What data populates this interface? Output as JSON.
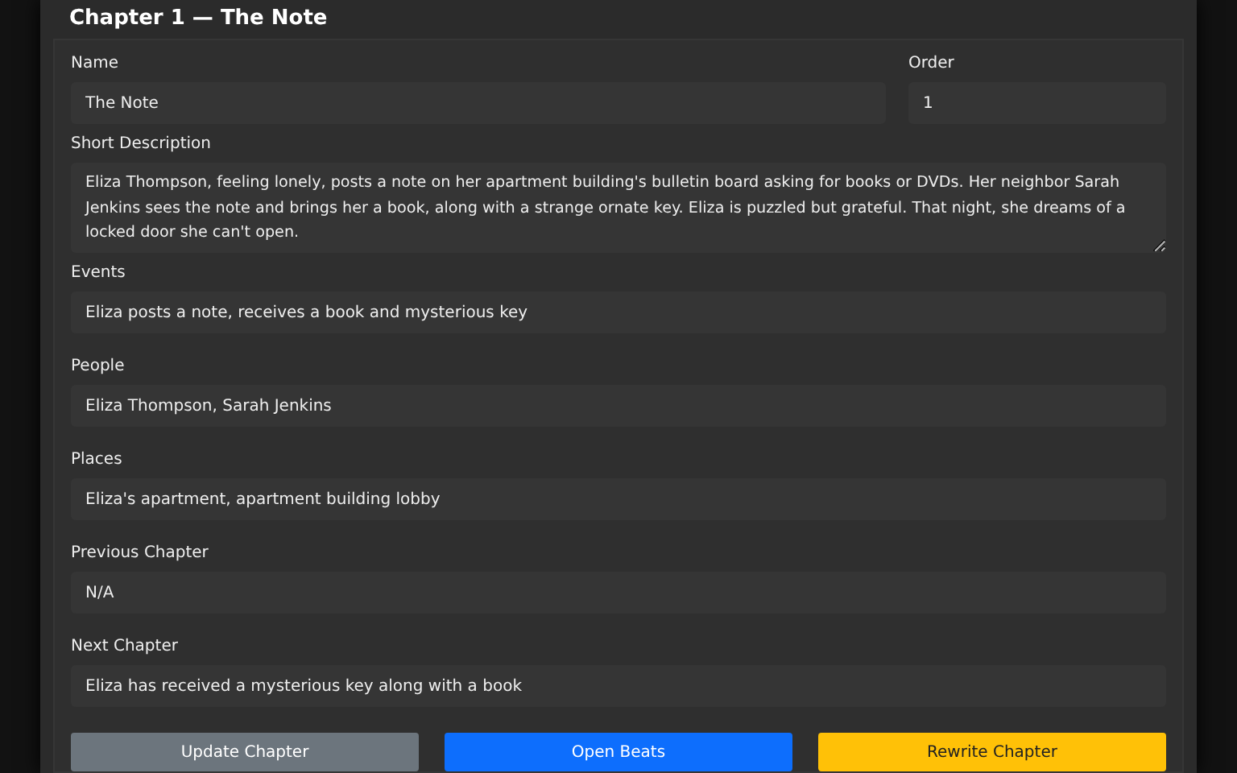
{
  "title": "Chapter 1 — The Note",
  "fields": [
    {
      "label": "Name",
      "value": "The Note",
      "kind": "text"
    },
    {
      "label": "Order",
      "value": "1",
      "kind": "text"
    },
    {
      "label": "Short Description",
      "value": "Eliza Thompson, feeling lonely, posts a note on her apartment building's bulletin board asking for books or DVDs. Her neighbor Sarah Jenkins sees the note and brings her a book, along with a strange ornate key. Eliza is puzzled but grateful. That night, she dreams of a locked door she can't open.",
      "kind": "textarea"
    },
    {
      "label": "Events",
      "value": "Eliza posts a note, receives a book and mysterious key",
      "kind": "text"
    },
    {
      "label": "People",
      "value": "Eliza Thompson, Sarah Jenkins",
      "kind": "text"
    },
    {
      "label": "Places",
      "value": "Eliza's apartment, apartment building lobby",
      "kind": "text"
    },
    {
      "label": "Previous Chapter",
      "value": "N/A",
      "kind": "text"
    },
    {
      "label": "Next Chapter",
      "value": "Eliza has received a mysterious key along with a book",
      "kind": "text"
    }
  ],
  "buttons": [
    {
      "label": "Update Chapter",
      "color": "#6c757d"
    },
    {
      "label": "Open Beats",
      "color": "#0d6efd"
    },
    {
      "label": "Rewrite Chapter",
      "color": "#ffc107"
    }
  ]
}
